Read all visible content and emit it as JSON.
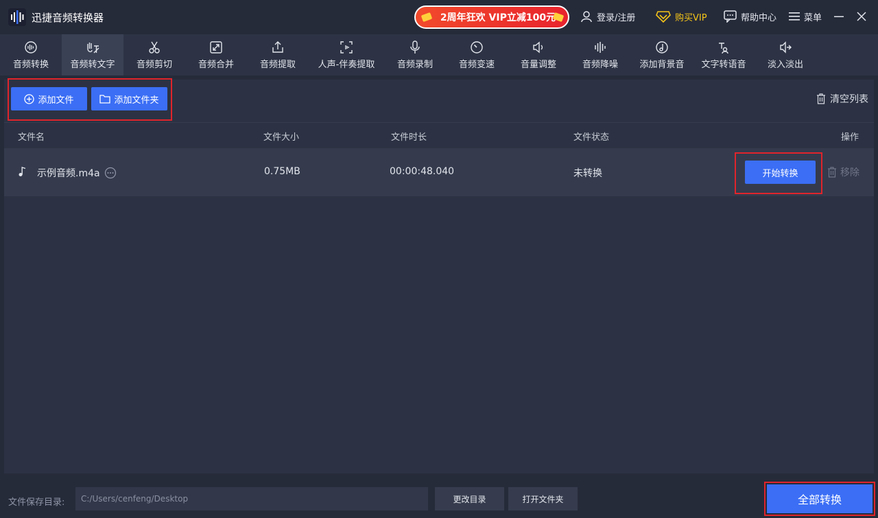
{
  "app": {
    "title": "迅捷音频转换器",
    "promo": "2周年狂欢 VIP立减100元",
    "login": "登录/注册",
    "buy_vip": "购买VIP",
    "help": "帮助中心",
    "menu": "菜单"
  },
  "toolbar": {
    "items": [
      {
        "label": "音频转换",
        "icon": "waveform-circle-icon"
      },
      {
        "label": "音频转文字",
        "icon": "hand-text-icon"
      },
      {
        "label": "音频剪切",
        "icon": "scissors-icon"
      },
      {
        "label": "音频合并",
        "icon": "merge-arrows-icon"
      },
      {
        "label": "音频提取",
        "icon": "upload-box-icon"
      },
      {
        "label": "人声-伴奏提取",
        "icon": "voice-scan-icon"
      },
      {
        "label": "音频录制",
        "icon": "microphone-icon"
      },
      {
        "label": "音频变速",
        "icon": "speed-dial-icon"
      },
      {
        "label": "音量调整",
        "icon": "speaker-icon"
      },
      {
        "label": "音频降噪",
        "icon": "noise-bars-icon"
      },
      {
        "label": "添加背景音",
        "icon": "music-disc-icon"
      },
      {
        "label": "文字转语音",
        "icon": "text-speech-icon"
      },
      {
        "label": "淡入淡出",
        "icon": "fade-icon"
      }
    ],
    "active_index": 1
  },
  "actions": {
    "add_file": "添加文件",
    "add_folder": "添加文件夹",
    "clear_list": "清空列表"
  },
  "table": {
    "headers": {
      "name": "文件名",
      "size": "文件大小",
      "duration": "文件时长",
      "status": "文件状态",
      "action": "操作"
    },
    "rows": [
      {
        "name": "示例音频.m4a",
        "size": "0.75MB",
        "duration": "00:00:48.040",
        "status": "未转换",
        "start": "开始转换",
        "remove": "移除"
      }
    ]
  },
  "bottom": {
    "save_label": "文件保存目录:",
    "path": "C:/Users/cenfeng/Desktop",
    "change_dir": "更改目录",
    "open_folder": "打开文件夹",
    "convert_all": "全部转换"
  },
  "colors": {
    "accent": "#3b6ef5",
    "highlight_frame": "#e0242b",
    "vip_gold": "#f5c518"
  }
}
